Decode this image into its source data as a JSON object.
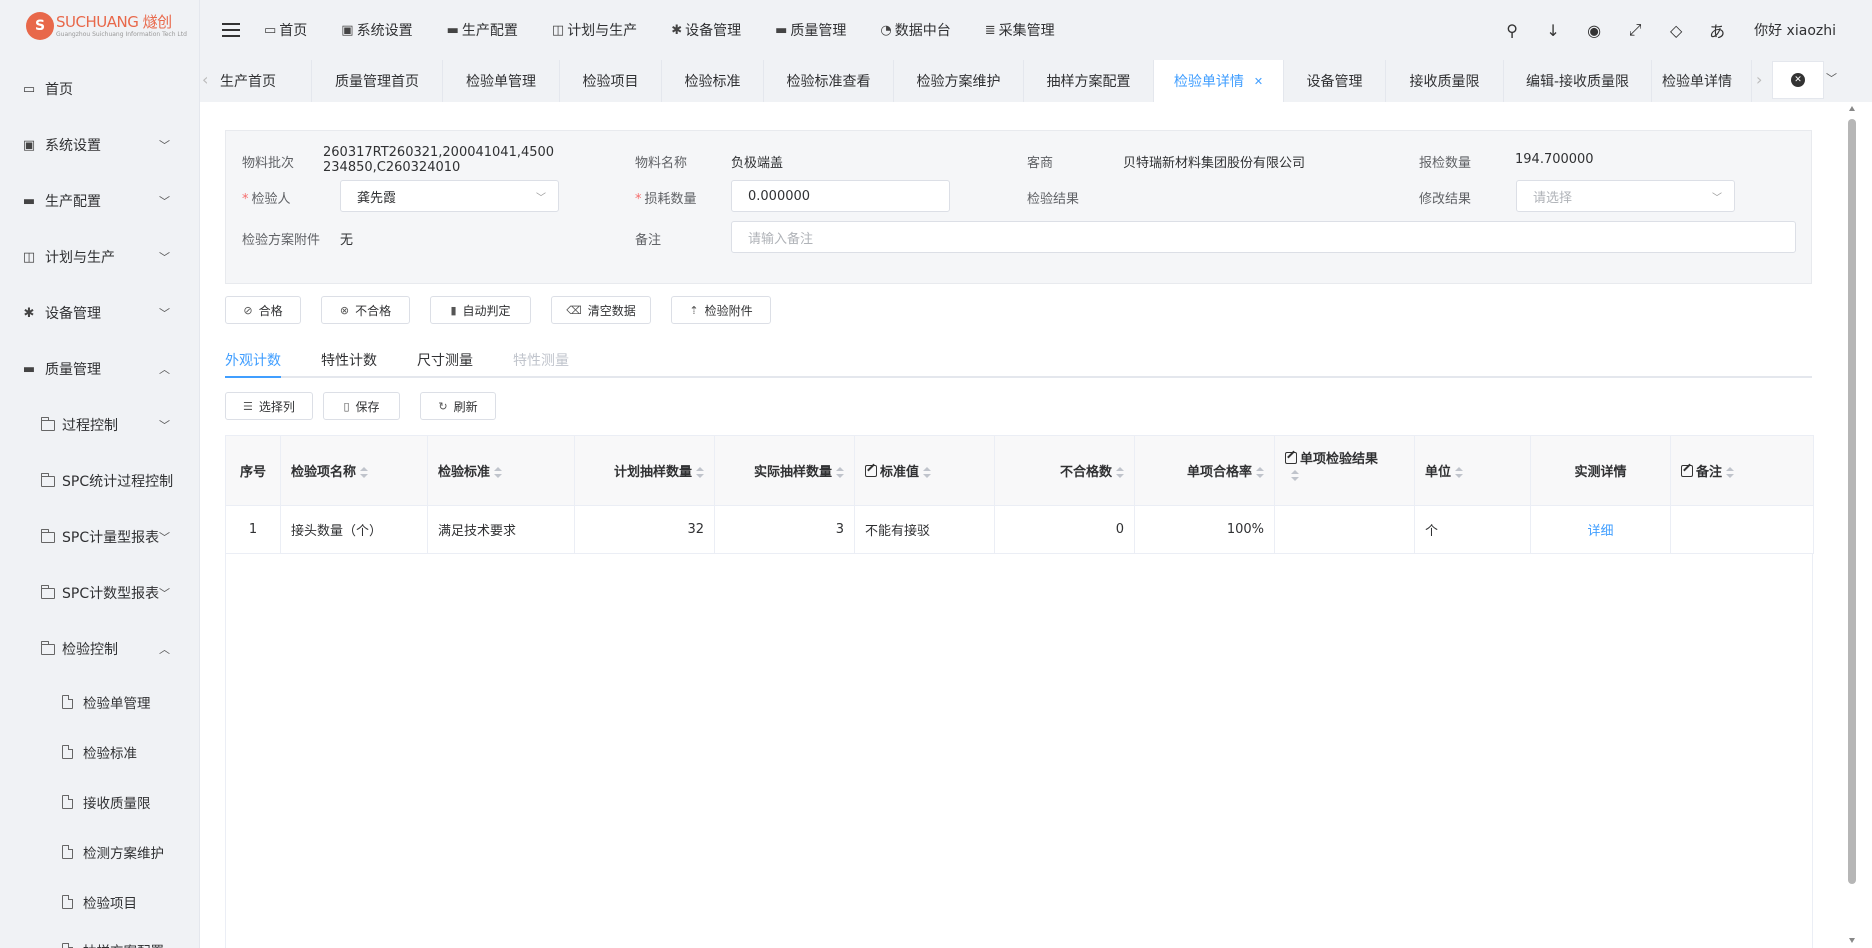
{
  "logo": {
    "mark": "S",
    "name": "SUCHUANG 燧创",
    "sub": "Guangzhou Suichuang Information Tech Ltd"
  },
  "sidebar": {
    "items": [
      {
        "label": "首页"
      },
      {
        "label": "系统设置"
      },
      {
        "label": "生产配置"
      },
      {
        "label": "计划与生产"
      },
      {
        "label": "设备管理"
      },
      {
        "label": "质量管理"
      },
      {
        "label": "过程控制"
      },
      {
        "label": "SPC统计过程控制"
      },
      {
        "label": "SPC计量型报表"
      },
      {
        "label": "SPC计数型报表"
      },
      {
        "label": "检验控制"
      },
      {
        "label": "检验单管理"
      },
      {
        "label": "检验标准"
      },
      {
        "label": "接收质量限"
      },
      {
        "label": "检测方案维护"
      },
      {
        "label": "检验项目"
      },
      {
        "label": "抽样方案配置"
      }
    ]
  },
  "topnav": {
    "items": [
      {
        "label": "首页",
        "icon": "monitor-icon"
      },
      {
        "label": "系统设置",
        "icon": "user-card-icon"
      },
      {
        "label": "生产配置",
        "icon": "briefcase-icon"
      },
      {
        "label": "计划与生产",
        "icon": "plan-icon"
      },
      {
        "label": "设备管理",
        "icon": "gear-icon"
      },
      {
        "label": "质量管理",
        "icon": "briefcase-icon"
      },
      {
        "label": "数据中台",
        "icon": "pie-icon"
      },
      {
        "label": "采集管理",
        "icon": "database-icon"
      }
    ],
    "greeting": "你好 xiaozhi"
  },
  "tabs": [
    {
      "label": "生产首页"
    },
    {
      "label": "质量管理首页"
    },
    {
      "label": "检验单管理"
    },
    {
      "label": "检验项目"
    },
    {
      "label": "检验标准"
    },
    {
      "label": "检验标准查看"
    },
    {
      "label": "检验方案维护"
    },
    {
      "label": "抽样方案配置"
    },
    {
      "label": "检验单详情",
      "active": true
    },
    {
      "label": "设备管理"
    },
    {
      "label": "接收质量限"
    },
    {
      "label": "编辑-接收质量限"
    },
    {
      "label": "检验单详情"
    }
  ],
  "form": {
    "batch_label": "物料批次",
    "batch_value": "260317RT260321,200041041,4500234850,C260324010",
    "material_label": "物料名称",
    "material_value": "负极端盖",
    "vendor_label": "客商",
    "vendor_value": "贝特瑞新材料集团股份有限公司",
    "qty_label": "报检数量",
    "qty_value": "194.700000",
    "inspector_label": "检验人",
    "inspector_value": "龚先霞",
    "loss_label": "损耗数量",
    "loss_value": "0.000000",
    "result_label": "检验结果",
    "result_value": "",
    "modify_label": "修改结果",
    "modify_placeholder": "请选择",
    "attach_label": "检验方案附件",
    "attach_value": "无",
    "remark_label": "备注",
    "remark_placeholder": "请输入备注"
  },
  "actions": {
    "pass": "合格",
    "fail": "不合格",
    "auto": "自动判定",
    "clear": "清空数据",
    "attach": "检验附件"
  },
  "subtabs": [
    "外观计数",
    "特性计数",
    "尺寸测量",
    "特性测量"
  ],
  "toolbar": {
    "columns": "选择列",
    "save": "保存",
    "refresh": "刷新"
  },
  "table": {
    "headers": [
      "序号",
      "检验项名称",
      "检验标准",
      "计划抽样数量",
      "实际抽样数量",
      "标准值",
      "不合格数",
      "单项合格率",
      "单项检验结果",
      "单位",
      "实测详情",
      "备注"
    ],
    "rows": [
      [
        "1",
        "接头数量（个）",
        "满足技术要求",
        "32",
        "3",
        "不能有接驳",
        "0",
        "100%",
        "",
        "个",
        "详细",
        ""
      ]
    ]
  },
  "colors": {
    "accent": "#409eff",
    "required": "#f56c6c",
    "brand": "#e8684a"
  }
}
